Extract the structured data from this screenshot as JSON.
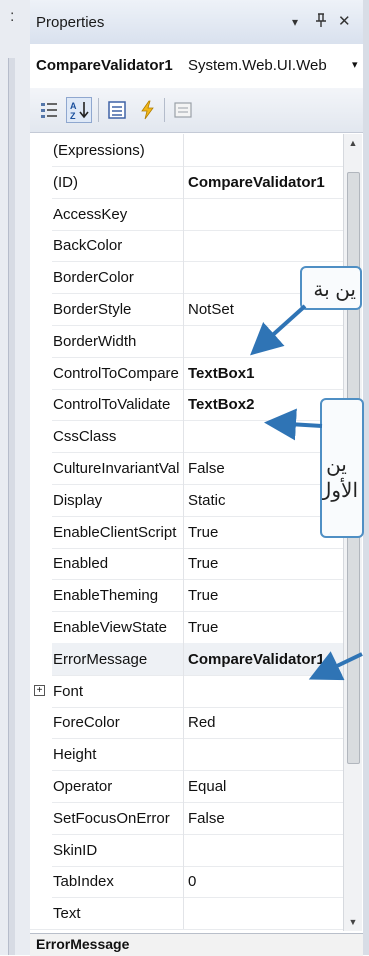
{
  "left_gutter": {
    "glyph": ":"
  },
  "window": {
    "title": "Properties",
    "dropdown_glyph": "▾",
    "pin_glyph": "ᚔ",
    "close_glyph": "✕"
  },
  "selector": {
    "object_name": "CompareValidator1",
    "object_type": "System.Web.UI.Web",
    "dropdown_glyph": "▾"
  },
  "toolbar": {
    "buttons": [
      {
        "name": "categorized",
        "icon": "categorized-icon"
      },
      {
        "name": "alphabetical",
        "icon": "sort-az-icon",
        "active": true
      },
      {
        "name": "properties",
        "icon": "properties-icon"
      },
      {
        "name": "events",
        "icon": "lightning-icon"
      },
      {
        "name": "property-pages",
        "icon": "property-pages-icon"
      }
    ]
  },
  "grid": {
    "rows": [
      {
        "name": "(Expressions)",
        "value": ""
      },
      {
        "name": "(ID)",
        "value": "CompareValidator1",
        "bold": true
      },
      {
        "name": "AccessKey",
        "value": ""
      },
      {
        "name": "BackColor",
        "value": ""
      },
      {
        "name": "BorderColor",
        "value": ""
      },
      {
        "name": "BorderStyle",
        "value": "NotSet"
      },
      {
        "name": "BorderWidth",
        "value": ""
      },
      {
        "name": "ControlToCompare",
        "value": "TextBox1",
        "bold": true
      },
      {
        "name": "ControlToValidate",
        "value": "TextBox2",
        "bold": true
      },
      {
        "name": "CssClass",
        "value": ""
      },
      {
        "name": "CultureInvariantValues",
        "value": "False"
      },
      {
        "name": "Display",
        "value": "Static"
      },
      {
        "name": "EnableClientScript",
        "value": "True"
      },
      {
        "name": "Enabled",
        "value": "True"
      },
      {
        "name": "EnableTheming",
        "value": "True"
      },
      {
        "name": "EnableViewState",
        "value": "True"
      },
      {
        "name": "ErrorMessage",
        "value": "CompareValidator1",
        "bold": true,
        "selected": true
      },
      {
        "name": "Font",
        "value": "",
        "expander": "+"
      },
      {
        "name": "ForeColor",
        "value": "Red"
      },
      {
        "name": "Height",
        "value": ""
      },
      {
        "name": "Operator",
        "value": "Equal"
      },
      {
        "name": "SetFocusOnError",
        "value": "False"
      },
      {
        "name": "SkinID",
        "value": ""
      },
      {
        "name": "TabIndex",
        "value": "0"
      },
      {
        "name": "Text",
        "value": ""
      }
    ]
  },
  "scrollbar": {
    "up_glyph": "▲",
    "down_glyph": "▼"
  },
  "description": {
    "title": "ErrorMessage"
  },
  "callouts": [
    {
      "text": "ين بة"
    },
    {
      "text": "ين\nالأول"
    }
  ],
  "colors": {
    "callout_border": "#4f8fc4",
    "arrow": "#2f74b5"
  }
}
